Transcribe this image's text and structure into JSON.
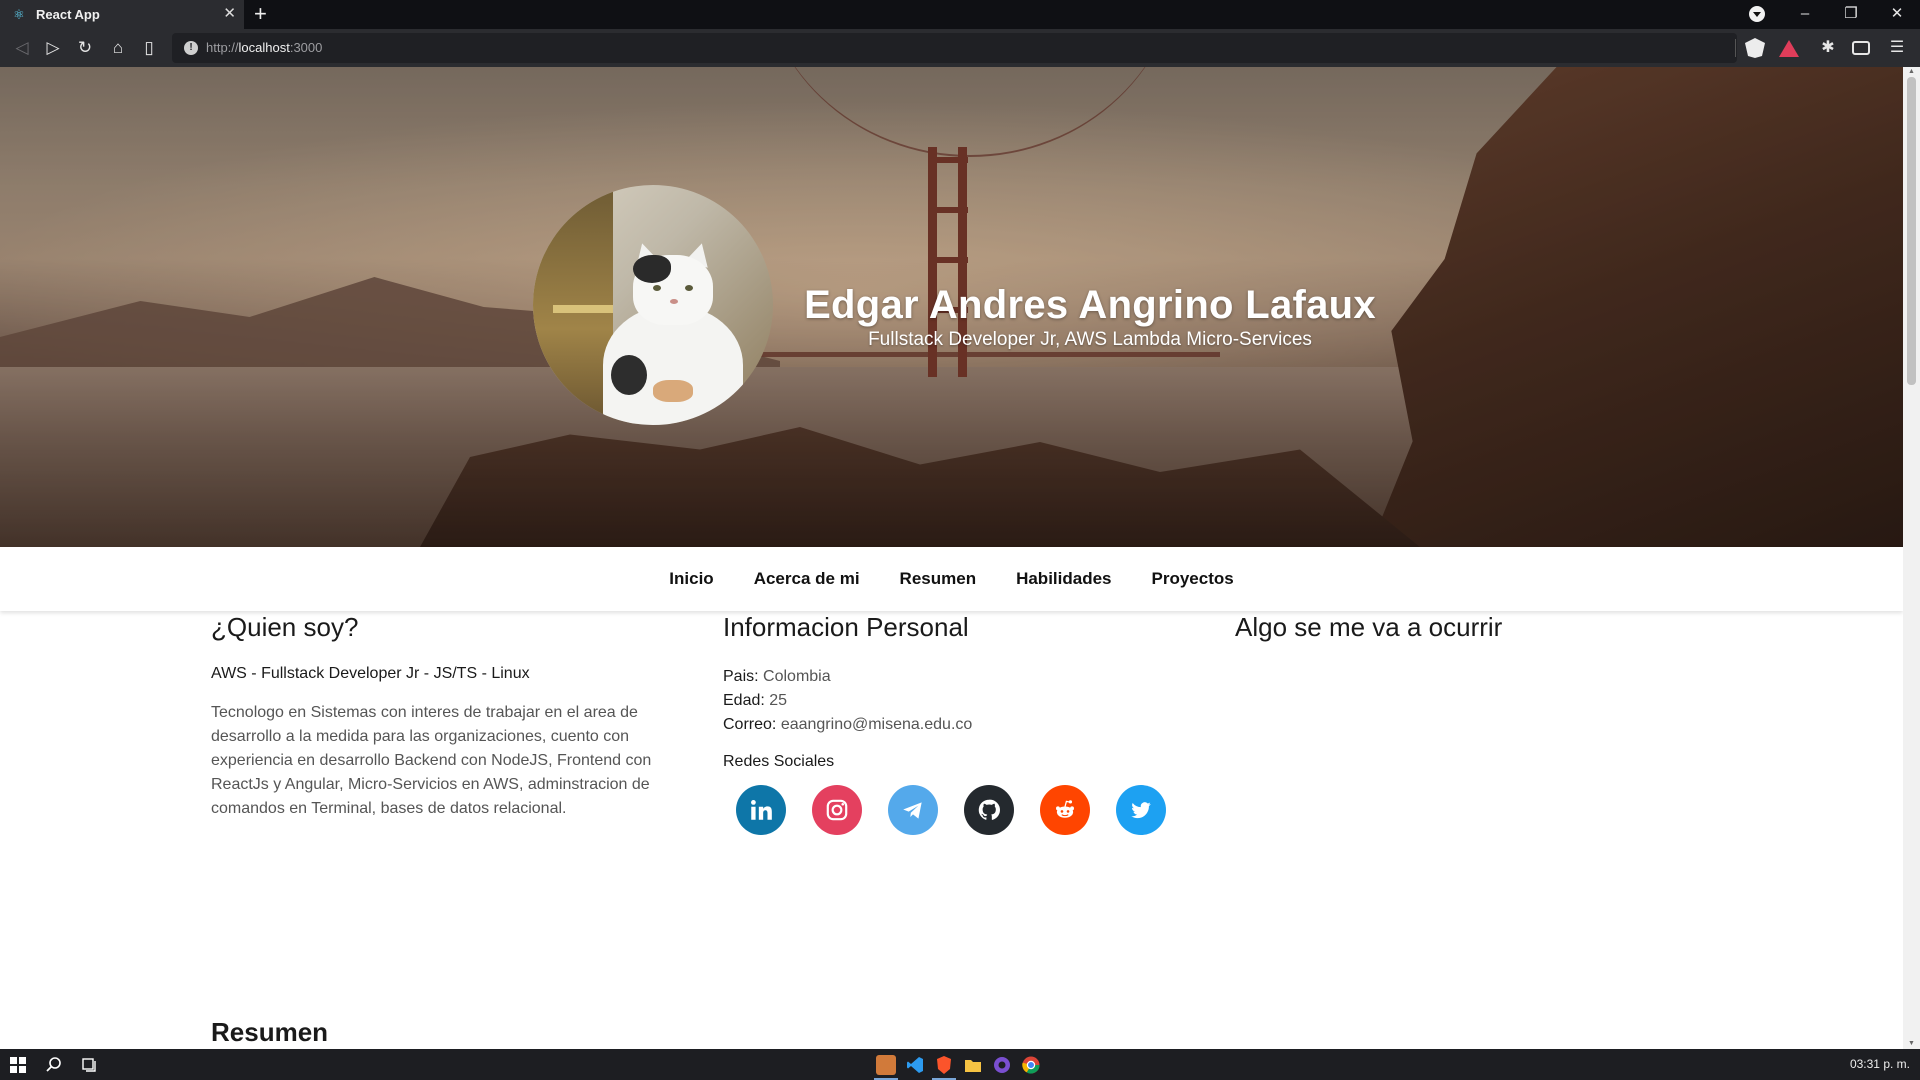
{
  "browser": {
    "tab_title": "React App",
    "url_scheme": "http://",
    "url_host": "localhost",
    "url_port": ":3000"
  },
  "hero": {
    "name": "Edgar Andres Angrino Lafaux",
    "role": "Fullstack Developer Jr, AWS Lambda Micro-Services"
  },
  "nav": {
    "items": [
      "Inicio",
      "Acerca de mi",
      "Resumen",
      "Habilidades",
      "Proyectos"
    ]
  },
  "about": {
    "title": "¿Quien soy?",
    "subtitle": "AWS - Fullstack Developer Jr - JS/TS - Linux",
    "description": "Tecnologo en Sistemas con interes de trabajar en el area de desarrollo a la medida para las organizaciones, cuento con experiencia en desarrollo Backend con NodeJS, Frontend con ReactJs y Angular, Micro-Servicios en AWS, adminstracion de comandos en Terminal, bases de datos relacional."
  },
  "personal": {
    "title": "Informacion Personal",
    "pais_label": "Pais:",
    "pais": "Colombia",
    "edad_label": "Edad:",
    "edad": "25",
    "correo_label": "Correo:",
    "correo": "eaangrino@misena.edu.co",
    "redes_title": "Redes Sociales",
    "socials": [
      {
        "name": "linkedin",
        "icon": "linkedin-icon",
        "color": "#0e76a8"
      },
      {
        "name": "instagram",
        "icon": "instagram-icon",
        "color": "#e4405f"
      },
      {
        "name": "telegram",
        "icon": "telegram-icon",
        "color": "#54a9eb"
      },
      {
        "name": "github",
        "icon": "github-icon",
        "color": "#24292e"
      },
      {
        "name": "reddit",
        "icon": "reddit-icon",
        "color": "#ff4500"
      },
      {
        "name": "twitter",
        "icon": "twitter-icon",
        "color": "#1da1f2"
      }
    ]
  },
  "extra": {
    "title": "Algo se me va a ocurrir"
  },
  "resumen": {
    "title": "Resumen"
  },
  "taskbar": {
    "clock": "03:31 p. m."
  }
}
